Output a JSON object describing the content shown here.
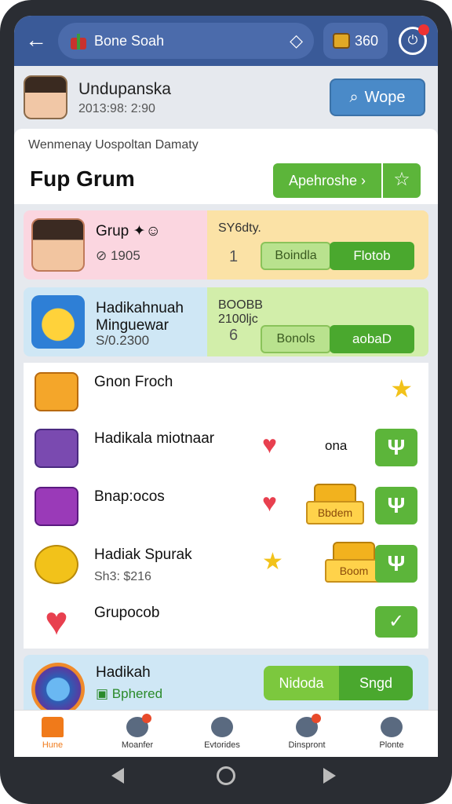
{
  "topbar": {
    "search_text": "Bone Soah",
    "coins": "360"
  },
  "profile": {
    "name": "Undupanska",
    "sub": "2013:98: 2:90",
    "action_label": "Wope"
  },
  "title_card": {
    "subtitle": "Wenmenay Uospoltan Damaty",
    "title": "Fup Grum",
    "approach_label": "Apehroshe"
  },
  "cards": [
    {
      "title": "Grup",
      "sub": "1905",
      "right_label": "SY6dty.",
      "right_num": "1",
      "btn_light": "Boindla",
      "btn_dark": "Flotob"
    },
    {
      "title": "Hadikahnuah Minguewar",
      "sub": "S/0.2300",
      "right_label": "BOOBB 2100ljc",
      "right_num": "6",
      "btn_light": "Bonols",
      "btn_dark": "aobaD"
    }
  ],
  "list": [
    {
      "title": "Gnon Froch",
      "sub": ""
    },
    {
      "title": "Hadikala miotnaar",
      "sub": "",
      "mid_text": "ona",
      "action": "Ψ"
    },
    {
      "title": "Bnap:ocos",
      "sub": "",
      "chest_label": "Bbdem",
      "action": "Ψ"
    },
    {
      "title": "Hadiak Spurak",
      "sub": "Sh3: $216",
      "chest_label": "Boom",
      "action": "Ψ"
    },
    {
      "title": "Grupocob",
      "sub": ""
    }
  ],
  "bottom_card": {
    "title": "Hadikah",
    "sub": "Bphered",
    "btn1": "Nidoda",
    "btn2": "Sngd"
  },
  "nav": [
    {
      "label": "Hune"
    },
    {
      "label": "Moanfer"
    },
    {
      "label": "Evtorides"
    },
    {
      "label": "Dinspront"
    },
    {
      "label": "Plonte"
    }
  ]
}
